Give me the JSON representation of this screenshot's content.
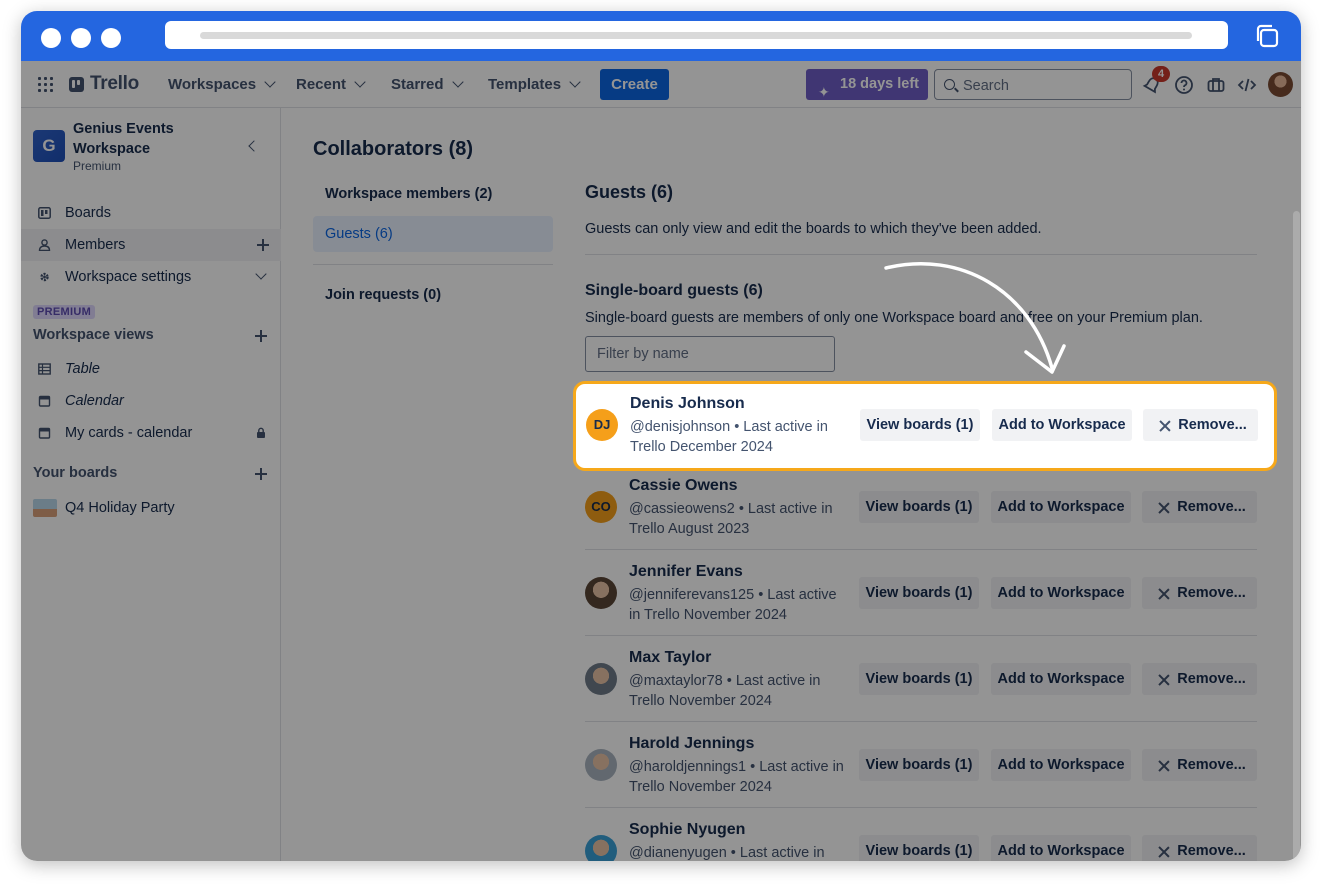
{
  "nav": {
    "brand": "Trello",
    "menus": [
      "Workspaces",
      "Recent",
      "Starred",
      "Templates"
    ],
    "create": "Create",
    "trial": "18 days left",
    "search_placeholder": "Search",
    "notifications_count": "4"
  },
  "sidebar": {
    "workspace_initial": "G",
    "workspace_name": "Genius Events Workspace",
    "workspace_plan": "Premium",
    "items": [
      {
        "label": "Boards",
        "icon": "board-icon"
      },
      {
        "label": "Members",
        "icon": "person-icon"
      },
      {
        "label": "Workspace settings",
        "icon": "gear-icon"
      }
    ],
    "premium_tag": "PREMIUM",
    "views_heading": "Workspace views",
    "views": [
      {
        "label": "Table",
        "icon": "table-icon"
      },
      {
        "label": "Calendar",
        "icon": "calendar-icon"
      },
      {
        "label": "My cards - calendar",
        "icon": "calendar-icon"
      }
    ],
    "boards_heading": "Your boards",
    "boards": [
      {
        "label": "Q4 Holiday Party"
      }
    ]
  },
  "main": {
    "title": "Collaborators (8)",
    "tabs": [
      {
        "label": "Workspace members (2)"
      },
      {
        "label": "Guests (6)"
      },
      {
        "label": "Join requests (0)"
      }
    ],
    "section_title": "Guests (6)",
    "section_desc": "Guests can only view and edit the boards to which they've been added.",
    "sub_title": "Single-board guests (6)",
    "sub_desc": "Single-board guests are members of only one Workspace board and free on your Premium plan.",
    "filter_placeholder": "Filter by name",
    "btn_view": "View boards (1)",
    "btn_add": "Add to Workspace",
    "btn_remove": "Remove...",
    "guests": [
      {
        "name": "Denis Johnson",
        "meta": "@denisjohnson • Last active in Trello December 2024",
        "initials": "DJ",
        "color": "#f59f1a"
      },
      {
        "name": "Cassie Owens",
        "meta": "@cassieowens2 • Last active in Trello August 2023",
        "initials": "CO",
        "color": "#f59f1a"
      },
      {
        "name": "Jennifer Evans",
        "meta": "@jenniferevans125 • Last active in Trello November 2024",
        "initials": "",
        "color": "#5b4636"
      },
      {
        "name": "Max Taylor",
        "meta": "@maxtaylor78 • Last active in Trello November 2024",
        "initials": "",
        "color": "#6e7a88"
      },
      {
        "name": "Harold Jennings",
        "meta": "@haroldjennings1 • Last active in Trello November 2024",
        "initials": "",
        "color": "#a9b4c0"
      },
      {
        "name": "Sophie Nyugen",
        "meta": "@dianenyugen • Last active in",
        "initials": "",
        "color": "#3aa0d8"
      }
    ]
  }
}
